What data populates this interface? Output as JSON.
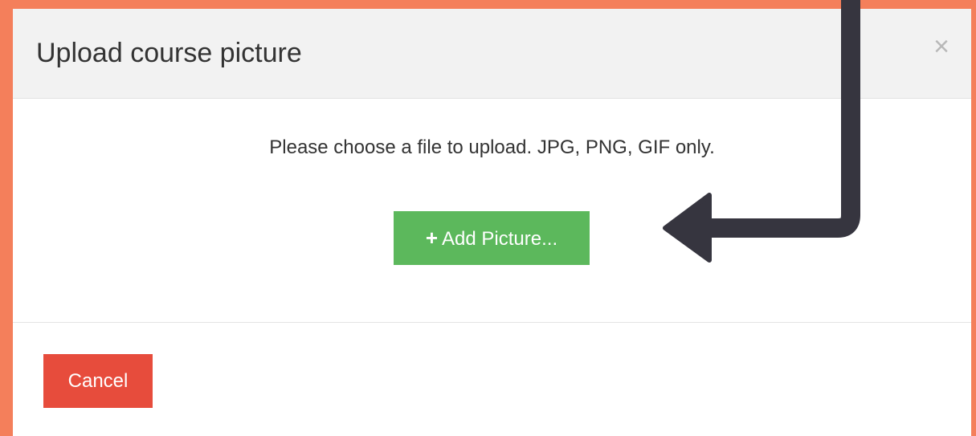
{
  "dialog": {
    "title": "Upload course picture",
    "close_symbol": "×"
  },
  "body": {
    "instructions": "Please choose a file to upload. JPG, PNG, GIF only.",
    "add_button": {
      "icon": "+",
      "label": "Add Picture..."
    }
  },
  "footer": {
    "cancel_label": "Cancel"
  },
  "colors": {
    "frame": "#f47f5b",
    "header_bg": "#f2f2f2",
    "add_button": "#5cb85c",
    "cancel_button": "#e74c3c",
    "annotation_arrow": "#36353f"
  }
}
